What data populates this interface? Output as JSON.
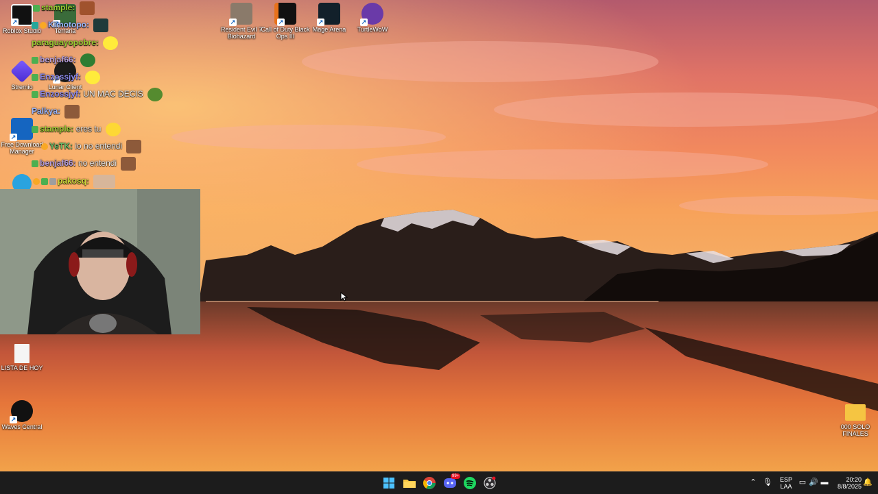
{
  "desktop_icons": [
    {
      "name": "roblox-studio",
      "label": "Roblox Studio"
    },
    {
      "name": "terraria",
      "label": "Terraria"
    },
    {
      "name": "stremio",
      "label": "Stremio"
    },
    {
      "name": "lunar-client",
      "label": "Lunar Client"
    },
    {
      "name": "free-download-manager",
      "label": "Free Download Manager"
    },
    {
      "name": "resident-evil",
      "label": "Resident Evil 7 Biohazard"
    },
    {
      "name": "call-of-duty",
      "label": "Call of Duty Black Ops III"
    },
    {
      "name": "mage-arena",
      "label": "Mage Arena"
    },
    {
      "name": "turtlewow",
      "label": "TurtleWoW"
    },
    {
      "name": "lista-de-hoy",
      "label": "LISTA DE HOY"
    },
    {
      "name": "waves-central",
      "label": "Waves Central"
    },
    {
      "name": "solo-finales",
      "label": "000 SOLO FINALES"
    }
  ],
  "chat": [
    {
      "user": "stample",
      "sep": ":",
      "text": "",
      "user_color": "#9acd32"
    },
    {
      "user": "Kimotopo",
      "sep": ":",
      "text": "",
      "user_color": "#9ab7ff"
    },
    {
      "user": "paraguayopobre",
      "sep": ":",
      "text": "",
      "user_color": "#9acd32"
    },
    {
      "user": "benjaf66",
      "sep": ":",
      "text": "",
      "user_color": "#b39ddb"
    },
    {
      "user": "Enzossjyf",
      "sep": ":",
      "text": "",
      "user_color": "#8e8cf0"
    },
    {
      "user": "Enzossjyf",
      "sep": ":",
      "text": "UN MAC DECIS",
      "user_color": "#8e8cf0"
    },
    {
      "user": "Palkya",
      "sep": ":",
      "text": "",
      "user_color": "#9ab7ff"
    },
    {
      "user": "stample",
      "sep": ":",
      "text": "eres tu",
      "user_color": "#9acd32"
    },
    {
      "user": "YeTK",
      "sep": ":",
      "text": "io no entendi",
      "user_color": "#66bb6a"
    },
    {
      "user": "benjaf66",
      "sep": ":",
      "text": "no entendi",
      "user_color": "#b39ddb"
    },
    {
      "user": "pakosq",
      "sep": ":",
      "text": "",
      "user_color": "#cddc39"
    }
  ],
  "taskbar": {
    "apps": [
      "windows-start",
      "file-explorer",
      "chrome",
      "discord",
      "spotify",
      "obs"
    ],
    "discord_badge": "99+",
    "language": "ESP",
    "layout": "LAA",
    "time": "20:20",
    "date": "8/8/2025"
  },
  "colors": {
    "taskbar": "#1c1c1c",
    "accent": "#0078d4"
  }
}
